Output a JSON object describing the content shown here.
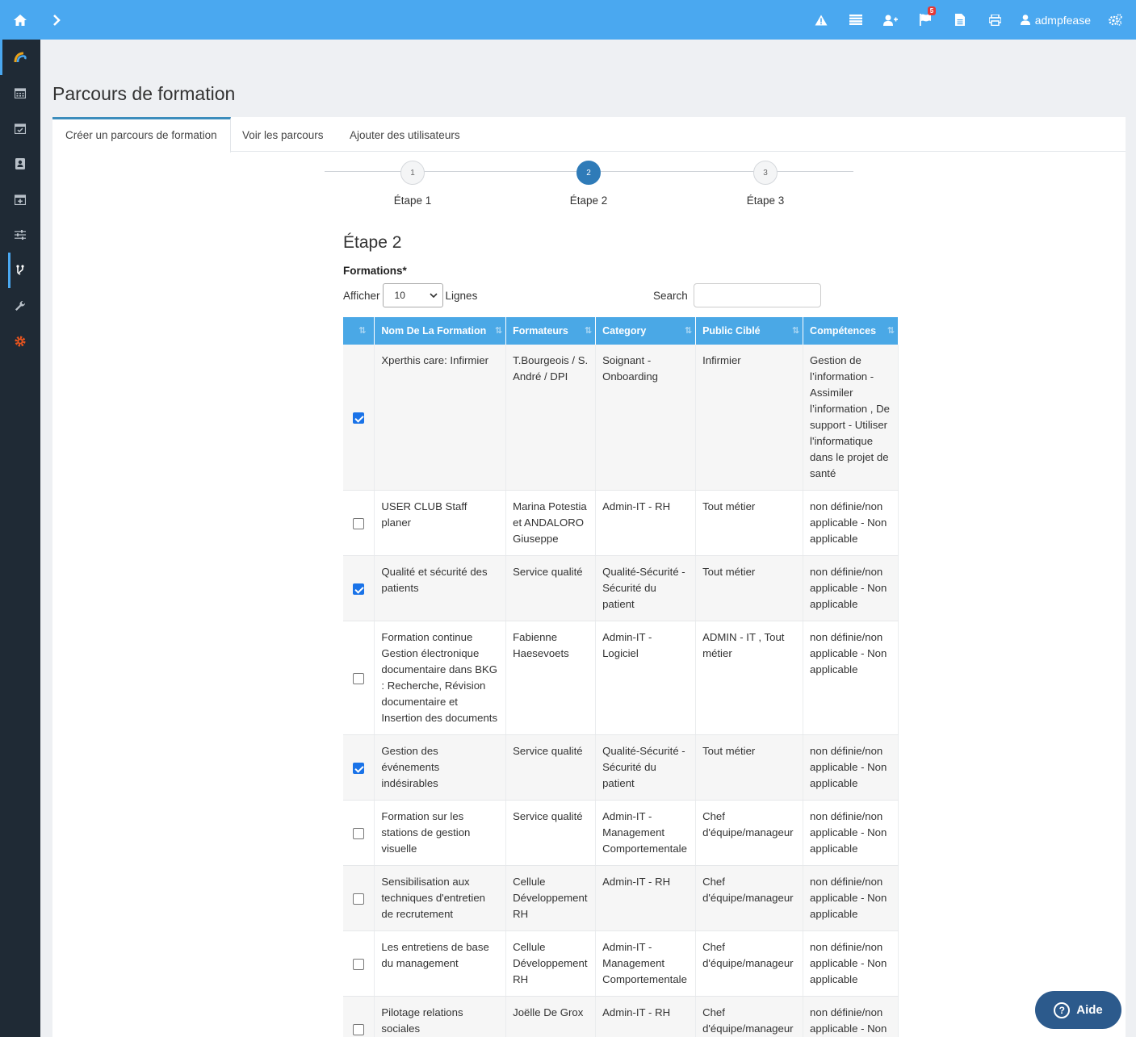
{
  "topbar": {
    "username": "admpfease",
    "flag_badge": "5",
    "icons": [
      "home-icon",
      "chevron-right-icon",
      "warning-icon",
      "list-icon",
      "user-plus-icon",
      "flag-icon",
      "file-icon",
      "print-icon",
      "user-icon",
      "cogs-icon"
    ]
  },
  "sidebar": {
    "items": [
      "logo-icon",
      "calendar-icon",
      "calendar-check-icon",
      "address-book-icon",
      "calendar-plus-icon",
      "sliders-icon",
      "code-fork-icon",
      "wrench-icon",
      "gear-icon"
    ]
  },
  "page": {
    "title": "Parcours de formation"
  },
  "tabs": [
    {
      "label": "Créer un parcours de formation"
    },
    {
      "label": "Voir les parcours"
    },
    {
      "label": "Ajouter des utilisateurs"
    }
  ],
  "stepper": {
    "steps": [
      {
        "num": "1",
        "label": "Étape 1"
      },
      {
        "num": "2",
        "label": "Étape 2"
      },
      {
        "num": "3",
        "label": "Étape 3"
      }
    ],
    "current": 2
  },
  "section": {
    "title": "Étape 2",
    "field_label": "Formations*",
    "show_prefix": "Afficher",
    "show_value": "10",
    "show_suffix": "Lignes",
    "search_label": "Search",
    "search_value": ""
  },
  "table": {
    "headers": [
      "Nom De La Formation",
      "Formateurs",
      "Category",
      "Public Ciblé",
      "Compétences"
    ],
    "rows": [
      {
        "checked": true,
        "nom": "Xperthis care: Infirmier",
        "formateurs": "T.Bourgeois / S. André / DPI",
        "category": "Soignant - Onboarding",
        "public": "Infirmier",
        "competences": "Gestion de l’information - Assimiler l’information , De support - Utiliser l'informatique dans le projet de santé"
      },
      {
        "checked": false,
        "nom": "USER CLUB Staff planer",
        "formateurs": "Marina Potestia et ANDALORO Giuseppe",
        "category": "Admin-IT - RH",
        "public": "Tout métier",
        "competences": "non définie/non applicable - Non applicable"
      },
      {
        "checked": true,
        "nom": "Qualité et sécurité des patients",
        "formateurs": "Service qualité",
        "category": "Qualité-Sécurité - Sécurité du patient",
        "public": "Tout métier",
        "competences": "non définie/non applicable - Non applicable"
      },
      {
        "checked": false,
        "nom": "Formation continue Gestion électronique documentaire dans BKG : Recherche, Révision documentaire et Insertion des documents",
        "formateurs": "Fabienne Haesevoets",
        "category": "Admin-IT - Logiciel",
        "public": "ADMIN - IT , Tout métier",
        "competences": "non définie/non applicable - Non applicable"
      },
      {
        "checked": true,
        "nom": "Gestion des événements indésirables",
        "formateurs": "Service qualité",
        "category": "Qualité-Sécurité - Sécurité du patient",
        "public": "Tout métier",
        "competences": "non définie/non applicable - Non applicable"
      },
      {
        "checked": false,
        "nom": "Formation sur les stations de gestion visuelle",
        "formateurs": "Service qualité",
        "category": "Admin-IT - Management Comportementale",
        "public": "Chef d'équipe/manageur",
        "competences": "non définie/non applicable - Non applicable"
      },
      {
        "checked": false,
        "nom": "Sensibilisation aux techniques d'entretien de recrutement",
        "formateurs": "Cellule Développement RH",
        "category": "Admin-IT - RH",
        "public": "Chef d'équipe/manageur",
        "competences": "non définie/non applicable - Non applicable"
      },
      {
        "checked": false,
        "nom": "Les entretiens de base du management",
        "formateurs": "Cellule Développement RH",
        "category": "Admin-IT - Management Comportementale",
        "public": "Chef d'équipe/manageur",
        "competences": "non définie/non applicable - Non applicable"
      },
      {
        "checked": false,
        "nom": "Pilotage relations sociales",
        "formateurs": "Joëlle De Grox",
        "category": "Admin-IT - RH",
        "public": "Chef d'équipe/manageur",
        "competences": "non définie/non applicable - Non applicable"
      }
    ]
  },
  "help": {
    "label": "Aide"
  }
}
